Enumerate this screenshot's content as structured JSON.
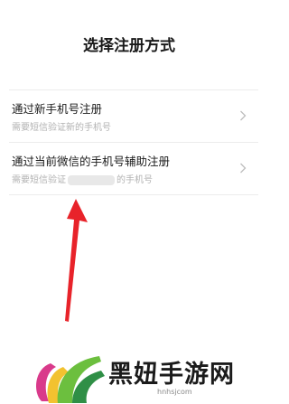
{
  "page": {
    "title": "选择注册方式"
  },
  "options": [
    {
      "title": "通过新手机号注册",
      "subtitle": "需要短信验证新的手机号"
    },
    {
      "title": "通过当前微信的手机号辅助注册",
      "subtitle_before": "需要短信验证",
      "subtitle_after": "的手机号"
    }
  ],
  "watermark": {
    "text": "黑妞手游网",
    "url": "hnhsjcom"
  },
  "colors": {
    "arrow": "#e8232a",
    "title": "#191919",
    "subtitle": "#b2b2b2",
    "divider": "#ececec"
  },
  "icons": [
    "chevron-right-icon",
    "red-arrow-annotation",
    "site-logo"
  ]
}
